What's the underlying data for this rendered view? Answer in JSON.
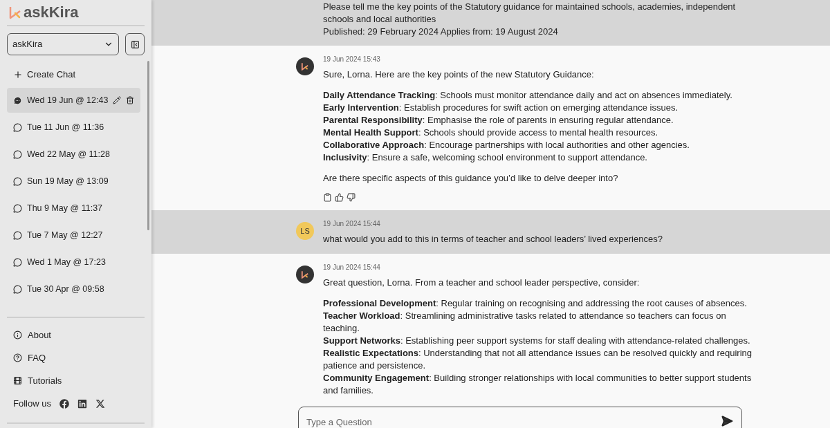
{
  "sidebar": {
    "brand": "askKira",
    "workspace_select": {
      "value": "askKira"
    },
    "create_chat": "Create Chat",
    "chats": [
      {
        "label": "Wed 19 Jun @ 12:43",
        "selected": true
      },
      {
        "label": "Tue 11 Jun @ 11:36",
        "selected": false
      },
      {
        "label": "Wed 22 May @ 11:28",
        "selected": false
      },
      {
        "label": "Sun 19 May @ 13:09",
        "selected": false
      },
      {
        "label": "Thu 9 May @ 11:37",
        "selected": false
      },
      {
        "label": "Tue 7 May @ 12:27",
        "selected": false
      },
      {
        "label": "Wed 1 May @ 17:23",
        "selected": false
      },
      {
        "label": "Tue 30 Apr @ 09:58",
        "selected": false
      }
    ],
    "links": [
      {
        "kind": "about",
        "label": "About"
      },
      {
        "kind": "faq",
        "label": "FAQ"
      },
      {
        "kind": "tutorials",
        "label": "Tutorials"
      }
    ],
    "follow_us": "Follow us"
  },
  "messages": [
    {
      "kind": "user",
      "lines": [
        "Please tell me the key points of the Statutory guidance for maintained schools, academies, independent schools and local authorities",
        "Published: 29 February 2024 Applies from: 19 August 2024"
      ]
    },
    {
      "kind": "assistant",
      "time": "19 Jun 2024 15:43",
      "intro": "Sure, Lorna. Here are the key points of the new Statutory Guidance:",
      "points": [
        "**Daily Attendance Tracking**: Schools must monitor attendance daily and act on absences immediately.",
        "**Early Intervention**: Establish procedures for swift action on emerging attendance issues.",
        "**Parental Responsibility**: Emphasise the role of parents in ensuring regular attendance.",
        "**Mental Health Support**: Schools should provide access to mental health resources.",
        "**Collaborative Approach**: Encourage partnerships with local authorities and other agencies.",
        "**Inclusivity**: Ensure a safe, welcoming school environment to support attendance."
      ],
      "outro": "Are there specific aspects of this guidance you’d like to delve deeper into?",
      "actions": true
    },
    {
      "kind": "user",
      "initials": "LS",
      "time": "19 Jun 2024 15:44",
      "lines": [
        "what would you add to this in terms of teacher and school leaders’ lived experiences?"
      ]
    },
    {
      "kind": "assistant",
      "time": "19 Jun 2024 15:44",
      "intro": "Great question, Lorna. From a teacher and school leader perspective, consider:",
      "points": [
        "**Professional Development**: Regular training on recognising and addressing the root causes of absences.",
        "**Teacher Workload**: Streamlining administrative tasks related to attendance so teachers can focus on teaching.",
        "**Support Networks**: Establishing peer support systems for staff dealing with attendance-related challenges.",
        "**Realistic Expectations**: Understanding that not all attendance issues can be resolved quickly and requiring patience and persistence.",
        "**Community Engagement**: Building stronger relationships with local communities to better support students and families."
      ],
      "actions": false
    }
  ],
  "composer": {
    "placeholder": "Type a Question"
  }
}
